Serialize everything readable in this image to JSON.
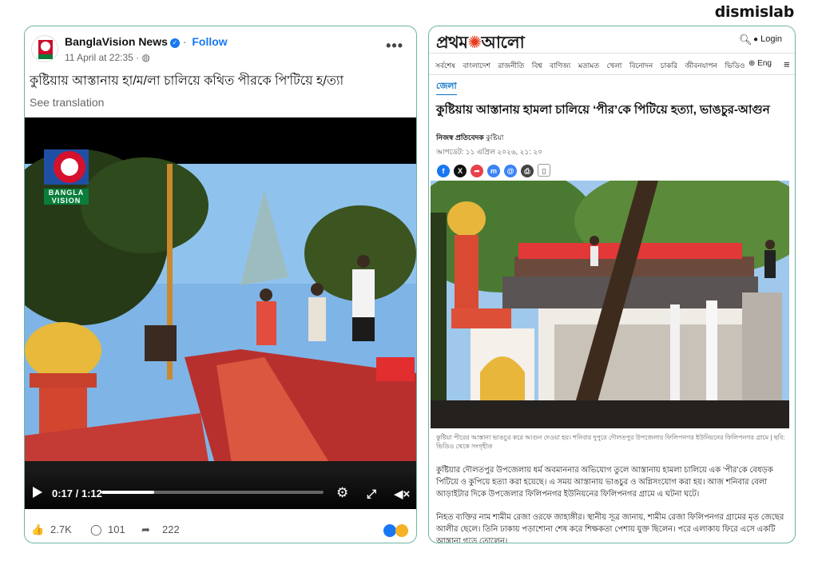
{
  "brand": "dismislab",
  "facebook": {
    "page_name": "BanglaVision News",
    "follow": "Follow",
    "dot": "·",
    "timestamp": "11 April at 22:35 · ",
    "caption": "কুষ্টিয়ায় আস্তানায় হা/ম/লা চালিয়ে কথিত পীরকে পি'টিয়ে হ/ত্যা",
    "see_translation": "See translation",
    "video": {
      "watermark_line1": "BANGLA",
      "watermark_line2": "VISION",
      "timecode": "0:17 / 1:12",
      "progress": 0.236
    },
    "reactions": {
      "likes": "2.7K",
      "comments": "101",
      "shares": "222"
    },
    "colors": {
      "accent": "#1877f2",
      "border": "#6fb3a6"
    }
  },
  "prothomalo": {
    "logo_a": "প্রথম",
    "logo_b": "আলো",
    "login": "Login",
    "nav": [
      "সর্বশেষ",
      "বাংলাদেশ",
      "রাজনীতি",
      "বিশ্ব",
      "বাণিজ্য",
      "মতামত",
      "খেলা",
      "বিনোদন",
      "চাকরি",
      "জীবনযাপন",
      "ভিডিও"
    ],
    "lang": "Eng",
    "section": "জেলা",
    "headline": "কুষ্টিয়ায় আস্তানায় হামলা চালিয়ে ‘পীর’কে পিটিয়ে হত্যা, ভাঙচুর-আগুন",
    "author": "নিজস্ব প্রতিবেদক",
    "author_place": "কুষ্টিয়া",
    "updated": "আপডেট: ১১ এপ্রিল ২০২৬, ২১: ২০",
    "share_icons": [
      "facebook-icon",
      "x-icon",
      "share-icon",
      "messenger-icon",
      "email-icon",
      "print-icon",
      "bookmark-icon"
    ],
    "photo_credit": "কুষ্টিয়া পীরের আস্তানা ভাঙচুর করে আগুন দেওয়া হয়। শনিবার দুপুরে দৌলতপুর উপজেলার ফিলিপনগর ইউনিয়নের ফিলিপনগর গ্রামে | ছবি: ভিডিও থেকে সংগৃহীত",
    "para1": "কুষ্টিয়ার দৌলতপুর উপজেলায় ধর্ম অবমাননার অভিযোগ তুলে আস্তানায় হামলা চালিয়ে এক ‘পীর’কে বেধড়ক পিটিয়ে ও কুপিয়ে হত্যা করা হয়েছে। এ সময় আস্তানায় ভাঙচুর ও অগ্নিসংযোগ করা হয়। আজ শনিবার বেলা আড়াইটার দিকে উপজেলার ফিলিপনগর ইউনিয়নের ফিলিপনগর গ্রামে এ ঘটনা ঘটে।",
    "para2": "নিহত ব্যক্তির নাম শামীম রেজা ওরফে জাহাঙ্গীর। স্থানীয় সূত্র জানায়, শামীম রেজা ফিলিপনগর গ্রামের মৃত জেছের আলীর ছেলে। তিনি ঢাকায় পড়াশোনা শেষ করে শিক্ষকতা পেশায় যুক্ত ছিলেন। পরে এলাকায় ফিরে এসে একটি আস্তানা গড়ে তোলেন।",
    "colors": {
      "logo_sun": "#e63b1d",
      "link": "#0a72c7"
    }
  }
}
